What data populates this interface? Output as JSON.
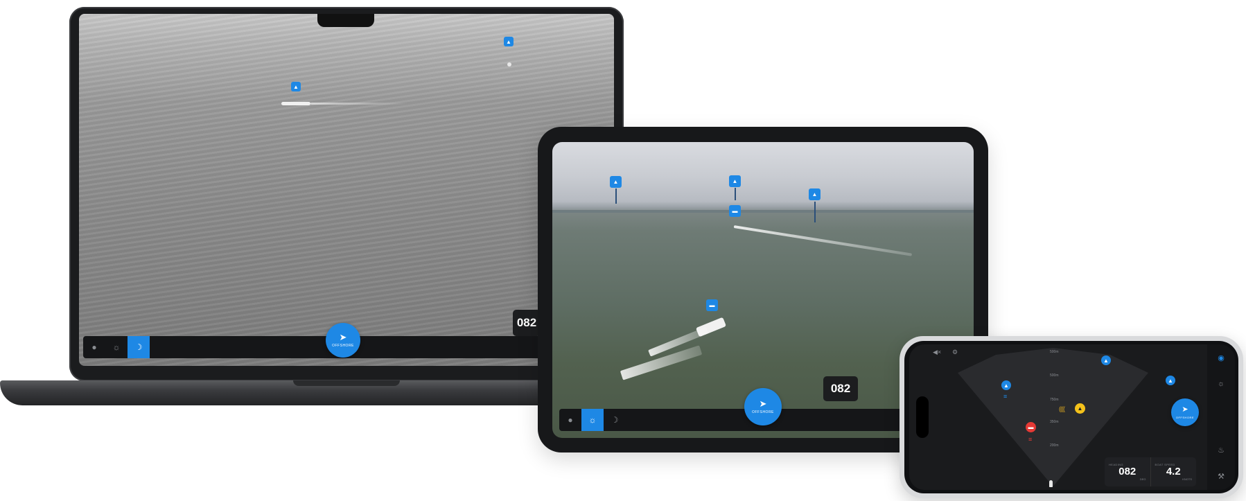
{
  "colors": {
    "accent": "#1e88e5",
    "alert": "#e53935",
    "warning": "#f4c21b"
  },
  "laptop": {
    "toolbar": {
      "buttons": [
        "pin-icon",
        "sun-icon",
        "moon-icon"
      ],
      "active_index": 2
    },
    "offshore_button": {
      "label": "OFFSHORE"
    },
    "readout": {
      "value": "082"
    }
  },
  "tablet": {
    "toolbar": {
      "buttons": [
        "pin-icon",
        "sun-icon",
        "moon-icon"
      ],
      "active_index": 1
    },
    "offshore_button": {
      "label": "OFFSHORE"
    },
    "readout": {
      "value": "082"
    }
  },
  "phone": {
    "range_labels": [
      "500m",
      "500m",
      "750m",
      "350m",
      "200m"
    ],
    "offshore_button": {
      "label": "OFFSHORE"
    },
    "heading": {
      "label": "HEADING",
      "value": "082",
      "unit": "DEG"
    },
    "boat_speed": {
      "label": "BOAT SPEED",
      "value": "4.2",
      "unit": "KNOTS"
    },
    "sidebar_icons": [
      "pin-icon",
      "sun-icon",
      "bell-icon",
      "wrench-icon"
    ]
  }
}
